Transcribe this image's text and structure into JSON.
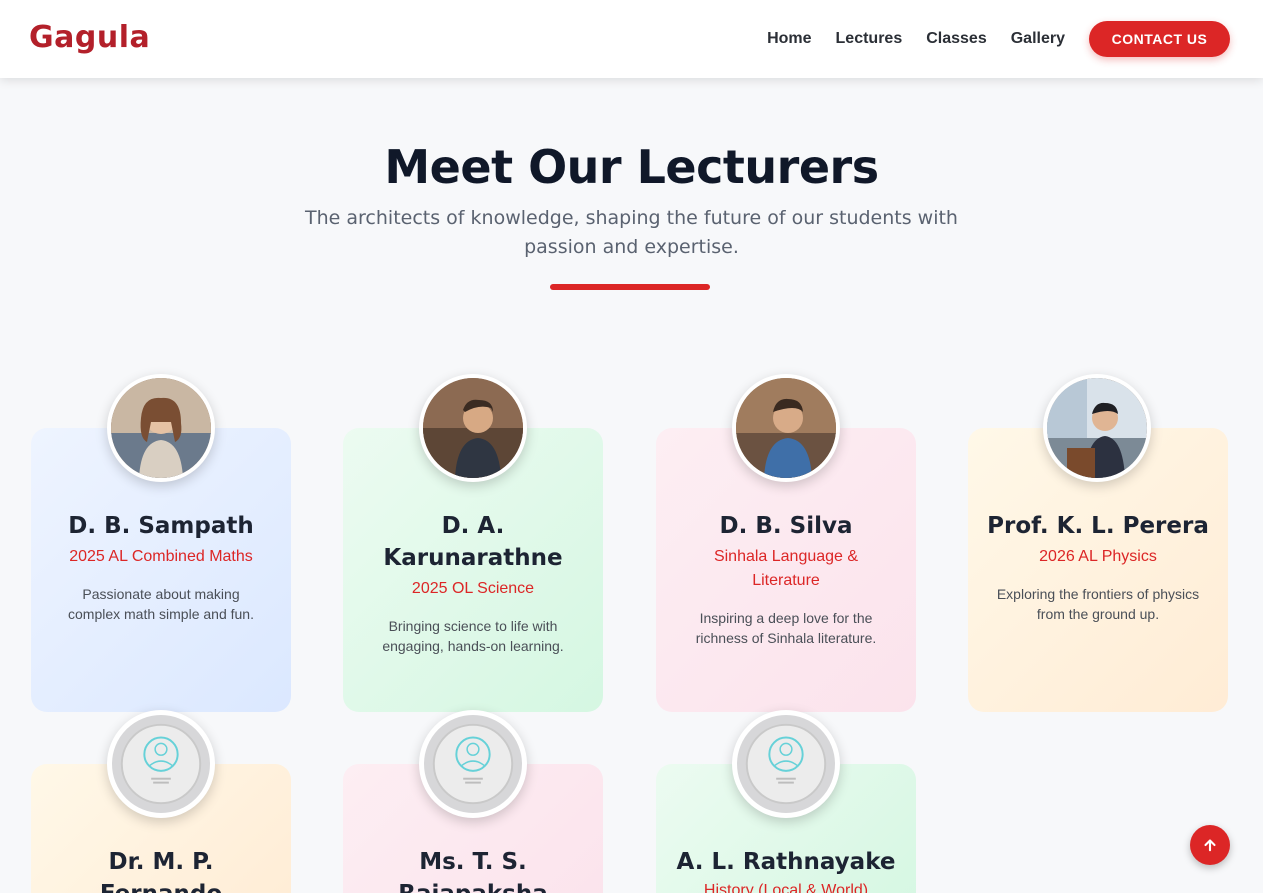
{
  "header": {
    "logo": "Gagula",
    "nav": [
      "Home",
      "Lectures",
      "Classes",
      "Gallery"
    ],
    "contact_label": "CONTACT US"
  },
  "hero": {
    "title": "Meet Our Lecturers",
    "subtitle": "The architects of knowledge, shaping the future of our students with passion and expertise."
  },
  "lecturers": [
    {
      "name": "D. B. Sampath",
      "subject": "2025 AL Combined Maths",
      "description": "Passionate about making complex math simple and fun."
    },
    {
      "name": "D. A. Karunarathne",
      "subject": "2025 OL Science",
      "description": "Bringing science to life with engaging, hands-on learning."
    },
    {
      "name": "D. B. Silva",
      "subject": "Sinhala Language & Literature",
      "description": "Inspiring a deep love for the richness of Sinhala literature."
    },
    {
      "name": "Prof. K. L. Perera",
      "subject": "2026 AL Physics",
      "description": "Exploring the frontiers of physics from the ground up."
    },
    {
      "name": "Dr. M. P. Fernando",
      "subject": "",
      "description": ""
    },
    {
      "name": "Ms. T. S. Rajapaksha",
      "subject": "",
      "description": ""
    },
    {
      "name": "A. L. Rathnayake",
      "subject": "History (Local & World)",
      "description": ""
    }
  ],
  "colors": {
    "brand": "#b3202a",
    "accent": "#dc2626"
  },
  "icons": {
    "scroll_top": "arrow-up-icon",
    "placeholder": "user-placeholder-icon"
  }
}
